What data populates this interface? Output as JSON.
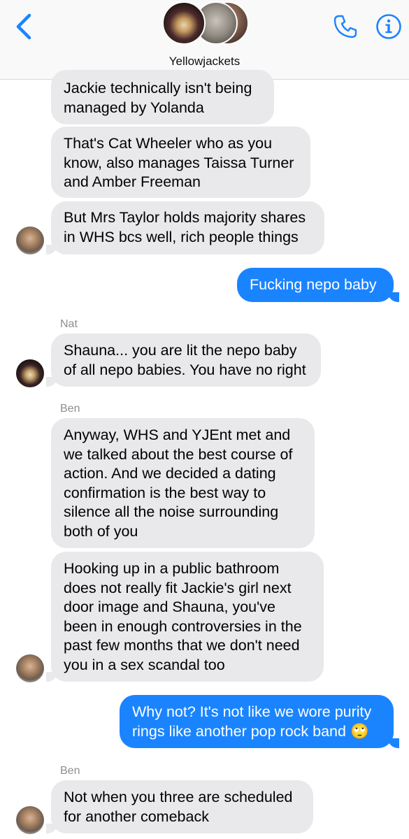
{
  "header": {
    "group_name": "Yellowjackets",
    "back_icon": "chevron-left-icon",
    "call_icon": "phone-icon",
    "info_icon": "info-icon",
    "accent_color": "#1a84ff"
  },
  "messages": [
    {
      "lines": [
        "Jackie technically isn't being",
        "managed by Yolanda"
      ]
    },
    {
      "lines": [
        "That's Cat Wheeler who as you",
        "know, also manages Taissa Turner",
        "and Amber Freeman"
      ]
    },
    {
      "lines": [
        "But Mrs Taylor holds majority shares",
        "in WHS bcs well, rich people things"
      ]
    },
    {
      "lines": [
        "Fucking nepo baby"
      ]
    },
    {
      "sender": "Nat",
      "lines": [
        "Shauna... you are lit the nepo baby",
        "of all nepo babies. You have no right"
      ]
    },
    {
      "sender": "Ben",
      "lines": [
        "Anyway, WHS and YJEnt met and",
        "we talked about the best course of",
        "action. And we decided a dating",
        "confirmation is the best way to",
        "silence all the noise surrounding",
        "both of you"
      ]
    },
    {
      "lines": [
        "Hooking up in a public bathroom",
        "does not really fit Jackie's girl next",
        "door image and Shauna, you've",
        "been in enough controversies in the",
        "past few months that we don't need",
        "you in a sex scandal too"
      ]
    },
    {
      "lines": [
        "Why not? It's not like we wore purity",
        "rings like another pop rock band 🙄"
      ]
    },
    {
      "sender": "Ben",
      "lines": [
        "Not when you three are scheduled",
        "for another comeback"
      ]
    }
  ]
}
